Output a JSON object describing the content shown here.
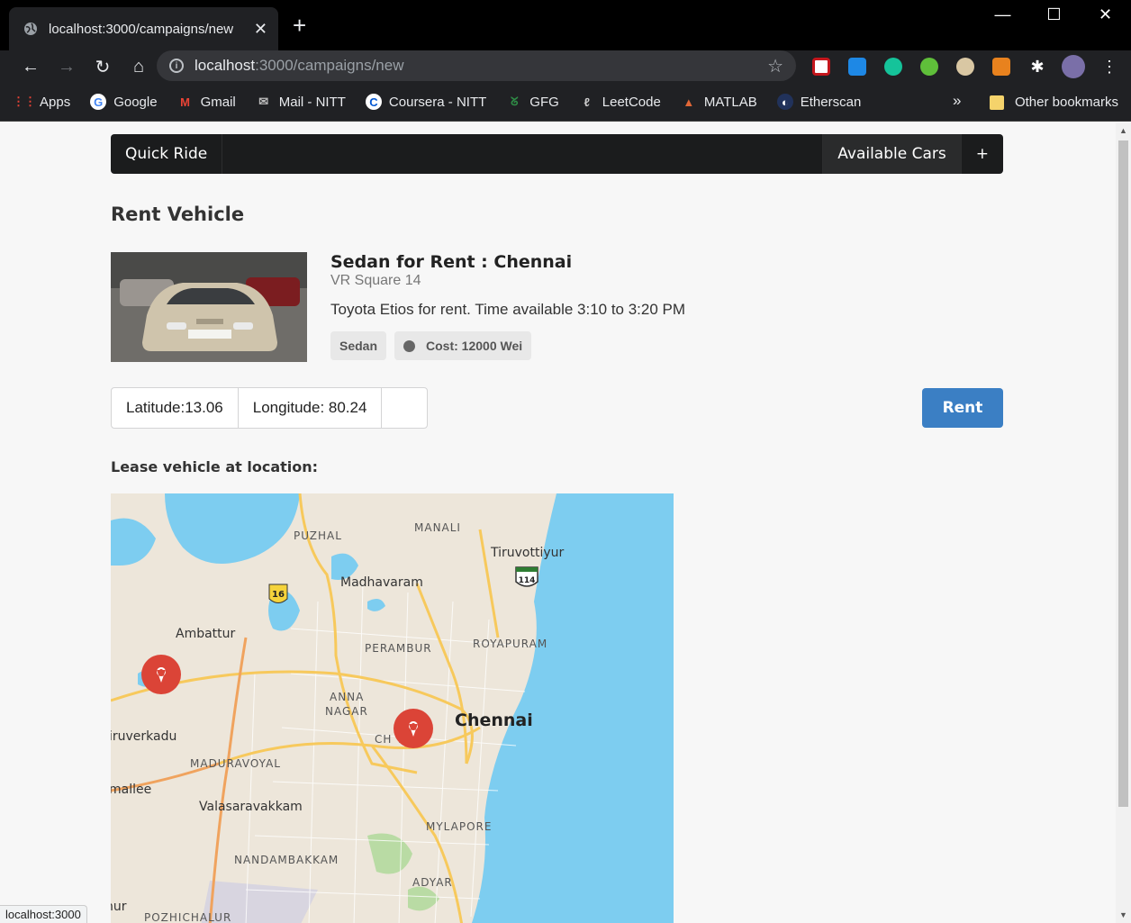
{
  "browser": {
    "tab_title": "localhost:3000/campaigns/new",
    "new_tab": "+",
    "url_host": "localhost",
    "url_path": ":3000/campaigns/new",
    "bookmarks": [
      {
        "label": "Apps",
        "icon": "apps-grid-icon"
      },
      {
        "label": "Google",
        "icon": "google-icon"
      },
      {
        "label": "Gmail",
        "icon": "gmail-icon"
      },
      {
        "label": "Mail - NITT",
        "icon": "mail-icon"
      },
      {
        "label": "Coursera - NITT",
        "icon": "coursera-icon"
      },
      {
        "label": "GFG",
        "icon": "gfg-icon"
      },
      {
        "label": "LeetCode",
        "icon": "leetcode-icon"
      },
      {
        "label": "MATLAB",
        "icon": "matlab-icon"
      },
      {
        "label": "Etherscan",
        "icon": "etherscan-icon"
      }
    ],
    "overflow": "»",
    "other_bookmarks": "Other bookmarks",
    "status_url": "localhost:3000"
  },
  "nav": {
    "brand": "Quick Ride",
    "available_cars": "Available Cars",
    "add": "+"
  },
  "page": {
    "title": "Rent Vehicle",
    "listing": {
      "header": "Sedan for Rent : Chennai",
      "meta": "VR Square 14",
      "description": "Toyota Etios for rent. Time available 3:10 to 3:20 PM",
      "label_type": "Sedan",
      "label_cost": "Cost: 12000 Wei"
    },
    "latitude": "Latitude:13.06",
    "longitude": "Longitude: 80.24",
    "rent_button": "Rent",
    "lease_label": "Lease vehicle at location:"
  },
  "map": {
    "places": {
      "manali": "MANALI",
      "puzhal": "PUZHAL",
      "tiruvottiyur": "Tiruvottiyur",
      "madhavaram": "Madhavaram",
      "ambattur": "Ambattur",
      "perambur": "PERAMBUR",
      "royapuram": "ROYAPURAM",
      "anna_nagar_1": "ANNA",
      "anna_nagar_2": "NAGAR",
      "chennai": "Chennai",
      "chetpet": "CH      T",
      "iruverkadu": "iruverkadu",
      "maduravoyal": "MADURAVOYAL",
      "mallee": "mallee",
      "valasaravakkam": "Valasaravakkam",
      "mylapore": "MYLAPORE",
      "nandambakkam": "NANDAMBAKKAM",
      "adyar": "ADYAR",
      "ur": "nur",
      "pozhichalur": "POZHICHALUR"
    },
    "shields": {
      "nh16": "16",
      "nh114": "114"
    },
    "colors": {
      "water": "#7dcdf0",
      "land": "#ede6da",
      "marker": "#db4437",
      "road": "#f7c95c"
    }
  }
}
